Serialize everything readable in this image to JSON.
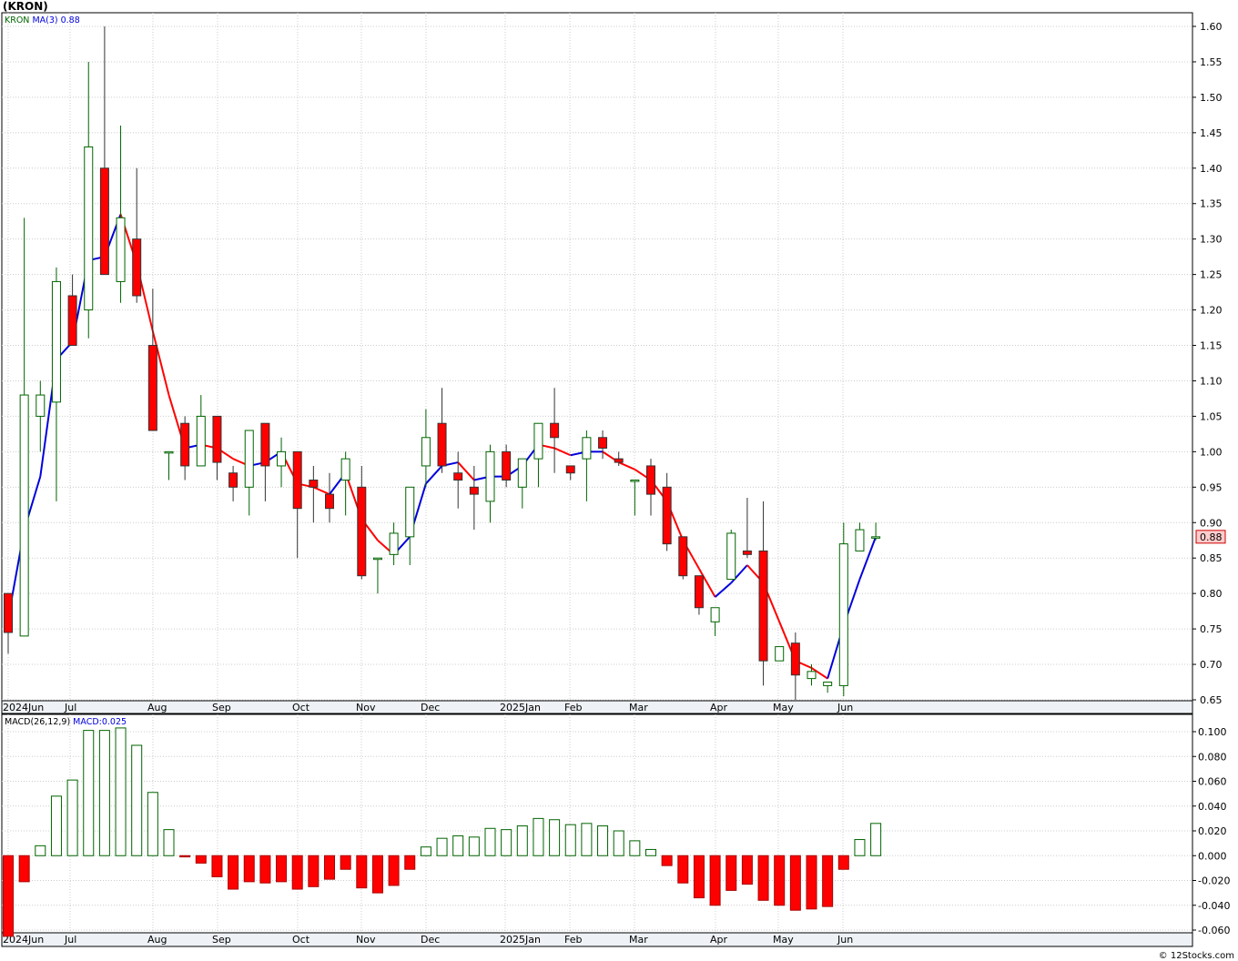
{
  "title": "(KRON)",
  "footer": "© 12Stocks.com",
  "colors": {
    "up_candle": "#006400",
    "down_candle": "#ff0000",
    "ma_up": "#0000dd",
    "ma_down": "#ff0000",
    "macd_pos": "#006400",
    "macd_neg": "#ff0000",
    "grid": "#cccccc",
    "price_label_bg": "#ffcccc"
  },
  "legend": {
    "symbol": "KRON",
    "ma_label": "MA(3)",
    "ma_value": "0.88",
    "macd_label": "MACD(26,12,9)",
    "macd_value": "MACD:0.025"
  },
  "last_price_label": "0.88",
  "x_axis_labels": [
    "2024Jun",
    "Jul",
    "Aug",
    "Sep",
    "Oct",
    "Nov",
    "Dec",
    "2025Jan",
    "Feb",
    "Mar",
    "Apr",
    "May",
    "Jun"
  ],
  "chart_data": [
    {
      "type": "candlestick",
      "title": "(KRON)",
      "period": "weekly",
      "ylim": [
        0.65,
        1.6
      ],
      "y_ticks": [
        "1.60",
        "1.55",
        "1.50",
        "1.45",
        "1.40",
        "1.35",
        "1.30",
        "1.25",
        "1.20",
        "1.15",
        "1.10",
        "1.05",
        "1.00",
        "0.95",
        "0.90",
        "0.85",
        "0.80",
        "0.75",
        "0.70",
        "0.65"
      ],
      "candles": [
        {
          "o": 0.8,
          "h": 0.8,
          "l": 0.715,
          "c": 0.745
        },
        {
          "o": 0.74,
          "h": 1.33,
          "l": 0.74,
          "c": 1.08
        },
        {
          "o": 1.05,
          "h": 1.1,
          "l": 1.0,
          "c": 1.08
        },
        {
          "o": 1.07,
          "h": 1.26,
          "l": 0.93,
          "c": 1.24
        },
        {
          "o": 1.22,
          "h": 1.25,
          "l": 1.15,
          "c": 1.15
        },
        {
          "o": 1.2,
          "h": 1.55,
          "l": 1.16,
          "c": 1.43
        },
        {
          "o": 1.4,
          "h": 1.6,
          "l": 1.25,
          "c": 1.25
        },
        {
          "o": 1.24,
          "h": 1.46,
          "l": 1.21,
          "c": 1.33
        },
        {
          "o": 1.3,
          "h": 1.4,
          "l": 1.21,
          "c": 1.22
        },
        {
          "o": 1.15,
          "h": 1.23,
          "l": 1.03,
          "c": 1.03
        },
        {
          "o": 1.0,
          "h": 1.0,
          "l": 0.96,
          "c": 1.0
        },
        {
          "o": 1.04,
          "h": 1.05,
          "l": 0.96,
          "c": 0.98
        },
        {
          "o": 0.98,
          "h": 1.08,
          "l": 0.98,
          "c": 1.05
        },
        {
          "o": 1.05,
          "h": 1.05,
          "l": 0.96,
          "c": 0.985
        },
        {
          "o": 0.97,
          "h": 0.98,
          "l": 0.93,
          "c": 0.95
        },
        {
          "o": 0.95,
          "h": 1.03,
          "l": 0.91,
          "c": 1.03
        },
        {
          "o": 1.04,
          "h": 1.04,
          "l": 0.93,
          "c": 0.98
        },
        {
          "o": 0.98,
          "h": 1.02,
          "l": 0.95,
          "c": 1.0
        },
        {
          "o": 1.0,
          "h": 1.0,
          "l": 0.85,
          "c": 0.92
        },
        {
          "o": 0.96,
          "h": 0.98,
          "l": 0.9,
          "c": 0.95
        },
        {
          "o": 0.94,
          "h": 0.97,
          "l": 0.9,
          "c": 0.92
        },
        {
          "o": 0.96,
          "h": 1.0,
          "l": 0.91,
          "c": 0.99
        },
        {
          "o": 0.95,
          "h": 0.98,
          "l": 0.82,
          "c": 0.825
        },
        {
          "o": 0.85,
          "h": 0.85,
          "l": 0.8,
          "c": 0.85
        },
        {
          "o": 0.855,
          "h": 0.9,
          "l": 0.84,
          "c": 0.885
        },
        {
          "o": 0.88,
          "h": 0.95,
          "l": 0.84,
          "c": 0.95
        },
        {
          "o": 0.98,
          "h": 1.06,
          "l": 0.95,
          "c": 1.02
        },
        {
          "o": 1.04,
          "h": 1.09,
          "l": 0.97,
          "c": 0.98
        },
        {
          "o": 0.97,
          "h": 1.0,
          "l": 0.92,
          "c": 0.96
        },
        {
          "o": 0.95,
          "h": 0.98,
          "l": 0.89,
          "c": 0.94
        },
        {
          "o": 0.93,
          "h": 1.01,
          "l": 0.9,
          "c": 1.0
        },
        {
          "o": 1.0,
          "h": 1.01,
          "l": 0.95,
          "c": 0.96
        },
        {
          "o": 0.95,
          "h": 0.99,
          "l": 0.92,
          "c": 0.99
        },
        {
          "o": 0.99,
          "h": 1.04,
          "l": 0.95,
          "c": 1.04
        },
        {
          "o": 1.04,
          "h": 1.09,
          "l": 0.97,
          "c": 1.02
        },
        {
          "o": 0.98,
          "h": 0.98,
          "l": 0.96,
          "c": 0.97
        },
        {
          "o": 0.99,
          "h": 1.03,
          "l": 0.93,
          "c": 1.02
        },
        {
          "o": 1.02,
          "h": 1.03,
          "l": 0.99,
          "c": 1.005
        },
        {
          "o": 0.99,
          "h": 1.0,
          "l": 0.98,
          "c": 0.985
        },
        {
          "o": 0.96,
          "h": 0.96,
          "l": 0.91,
          "c": 0.96
        },
        {
          "o": 0.98,
          "h": 0.99,
          "l": 0.91,
          "c": 0.94
        },
        {
          "o": 0.95,
          "h": 0.97,
          "l": 0.86,
          "c": 0.87
        },
        {
          "o": 0.88,
          "h": 0.88,
          "l": 0.82,
          "c": 0.825
        },
        {
          "o": 0.825,
          "h": 0.825,
          "l": 0.77,
          "c": 0.78
        },
        {
          "o": 0.76,
          "h": 0.78,
          "l": 0.74,
          "c": 0.78
        },
        {
          "o": 0.82,
          "h": 0.89,
          "l": 0.82,
          "c": 0.885
        },
        {
          "o": 0.86,
          "h": 0.935,
          "l": 0.85,
          "c": 0.855
        },
        {
          "o": 0.86,
          "h": 0.93,
          "l": 0.67,
          "c": 0.705
        },
        {
          "o": 0.705,
          "h": 0.725,
          "l": 0.705,
          "c": 0.725
        },
        {
          "o": 0.73,
          "h": 0.745,
          "l": 0.65,
          "c": 0.685
        },
        {
          "o": 0.68,
          "h": 0.7,
          "l": 0.67,
          "c": 0.69
        },
        {
          "o": 0.67,
          "h": 0.675,
          "l": 0.66,
          "c": 0.675
        },
        {
          "o": 0.67,
          "h": 0.9,
          "l": 0.655,
          "c": 0.87
        },
        {
          "o": 0.86,
          "h": 0.9,
          "l": 0.86,
          "c": 0.89
        },
        {
          "o": 0.88,
          "h": 0.9,
          "l": 0.875,
          "c": 0.88
        }
      ],
      "ma3": [
        0.765,
        0.89,
        0.965,
        1.13,
        1.155,
        1.27,
        1.275,
        1.335,
        1.265,
        1.17,
        1.08,
        1.005,
        1.01,
        1.005,
        0.99,
        0.98,
        0.985,
        1.0,
        0.955,
        0.95,
        0.94,
        0.97,
        0.905,
        0.875,
        0.855,
        0.88,
        0.955,
        0.98,
        0.985,
        0.96,
        0.965,
        0.965,
        0.98,
        1.01,
        1.005,
        0.995,
        1.0,
        1.0,
        0.985,
        0.975,
        0.96,
        0.93,
        0.875,
        0.835,
        0.795,
        0.815,
        0.84,
        0.815,
        0.76,
        0.705,
        0.695,
        0.68,
        0.755,
        0.82,
        0.88
      ]
    },
    {
      "type": "bar",
      "title": "MACD(26,12,9)",
      "ylim": [
        -0.062,
        0.104
      ],
      "y_ticks": [
        "0.100",
        "0.080",
        "0.060",
        "0.040",
        "0.020",
        "0.000",
        "-0.020",
        "-0.040",
        "-0.060"
      ],
      "values": [
        -0.065,
        -0.021,
        0.008,
        0.048,
        0.061,
        0.101,
        0.101,
        0.103,
        0.089,
        0.051,
        0.021,
        -0.001,
        -0.006,
        -0.017,
        -0.027,
        -0.021,
        -0.022,
        -0.021,
        -0.027,
        -0.025,
        -0.019,
        -0.011,
        -0.026,
        -0.03,
        -0.024,
        -0.011,
        0.007,
        0.014,
        0.016,
        0.015,
        0.022,
        0.021,
        0.024,
        0.03,
        0.029,
        0.025,
        0.026,
        0.024,
        0.02,
        0.012,
        0.005,
        -0.008,
        -0.022,
        -0.034,
        -0.04,
        -0.028,
        -0.023,
        -0.036,
        -0.04,
        -0.044,
        -0.043,
        -0.041,
        -0.011,
        0.013,
        0.026
      ]
    }
  ]
}
